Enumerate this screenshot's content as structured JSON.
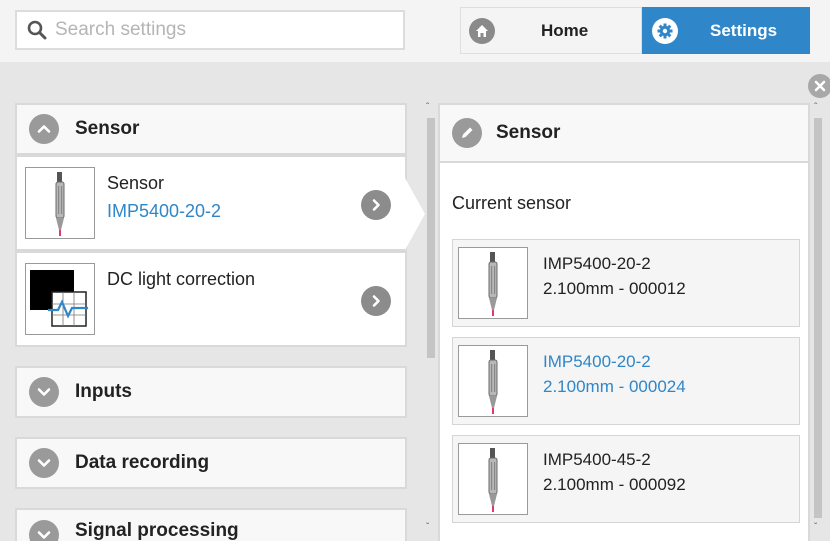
{
  "search": {
    "placeholder": "Search settings"
  },
  "nav": {
    "home_label": "Home",
    "settings_label": "Settings",
    "active": "Settings"
  },
  "accent_color": "#2f86c8",
  "icons": {
    "search": "search-icon",
    "home": "home-icon",
    "settings": "gear-icon",
    "close": "close-icon",
    "chevron_up": "chevron-up-icon",
    "chevron_down": "chevron-down-icon",
    "chevron_right": "chevron-right-icon",
    "edit": "pencil-icon",
    "sensor_probe": "sensor-probe-icon",
    "dc_light": "dc-light-correction-icon"
  },
  "left": {
    "sections": [
      {
        "label": "Sensor",
        "expanded": true
      },
      {
        "label": "Inputs",
        "expanded": false
      },
      {
        "label": "Data recording",
        "expanded": false
      },
      {
        "label": "Signal processing",
        "expanded": false
      }
    ],
    "sensor_items": [
      {
        "title": "Sensor",
        "value": "IMP5400-20-2",
        "active": true
      },
      {
        "title": "DC light correction",
        "value": "",
        "active": false
      }
    ]
  },
  "right": {
    "title": "Sensor",
    "subtitle": "Current sensor",
    "sensors": [
      {
        "name": "IMP5400-20-2",
        "spec": "2.100mm - 000012",
        "selected": false
      },
      {
        "name": "IMP5400-20-2",
        "spec": "2.100mm - 000024",
        "selected": true
      },
      {
        "name": "IMP5400-45-2",
        "spec": "2.100mm - 000092",
        "selected": false
      }
    ]
  }
}
